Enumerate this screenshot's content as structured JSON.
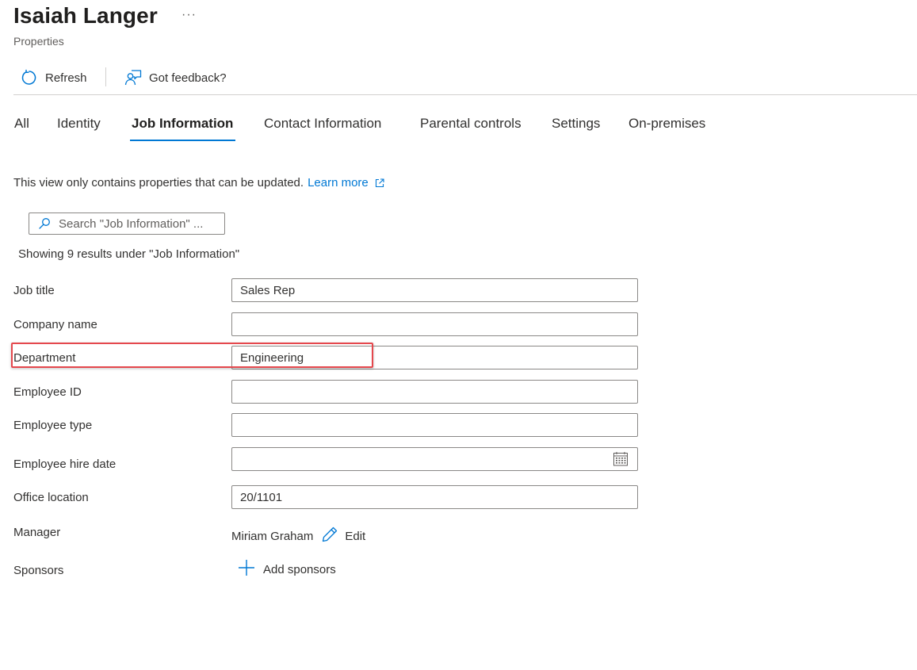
{
  "header": {
    "title": "Isaiah Langer",
    "more": "···",
    "subtitle": "Properties"
  },
  "toolbar": {
    "refresh_label": "Refresh",
    "feedback_label": "Got feedback?"
  },
  "tabs": [
    {
      "label": "All",
      "active": false
    },
    {
      "label": "Identity",
      "active": false
    },
    {
      "label": "Job Information",
      "active": true
    },
    {
      "label": "Contact Information",
      "active": false
    },
    {
      "label": "Parental controls",
      "active": false
    },
    {
      "label": "Settings",
      "active": false
    },
    {
      "label": "On-premises",
      "active": false
    }
  ],
  "info": {
    "text": "This view only contains properties that can be updated.",
    "link": "Learn more"
  },
  "search": {
    "placeholder": "Search \"Job Information\" ...",
    "results_text": "Showing 9 results under \"Job Information\""
  },
  "fields": {
    "job_title": {
      "label": "Job title",
      "value": "Sales Rep"
    },
    "company_name": {
      "label": "Company name",
      "value": ""
    },
    "department": {
      "label": "Department",
      "value": "Engineering"
    },
    "employee_id": {
      "label": "Employee ID",
      "value": ""
    },
    "employee_type": {
      "label": "Employee type",
      "value": ""
    },
    "hire_date": {
      "label": "Employee hire date",
      "value": ""
    },
    "office_location": {
      "label": "Office location",
      "value": "20/1101"
    }
  },
  "manager": {
    "label": "Manager",
    "name": "Miriam Graham",
    "edit_label": "Edit"
  },
  "sponsors": {
    "label": "Sponsors",
    "add_label": "Add sponsors"
  },
  "colors": {
    "accent": "#0078d4",
    "highlight_border": "#e5484d",
    "text": "#323130"
  },
  "icons": [
    "refresh-icon",
    "feedback-icon",
    "external-link-icon",
    "search-icon",
    "calendar-icon",
    "pencil-icon",
    "plus-icon"
  ]
}
